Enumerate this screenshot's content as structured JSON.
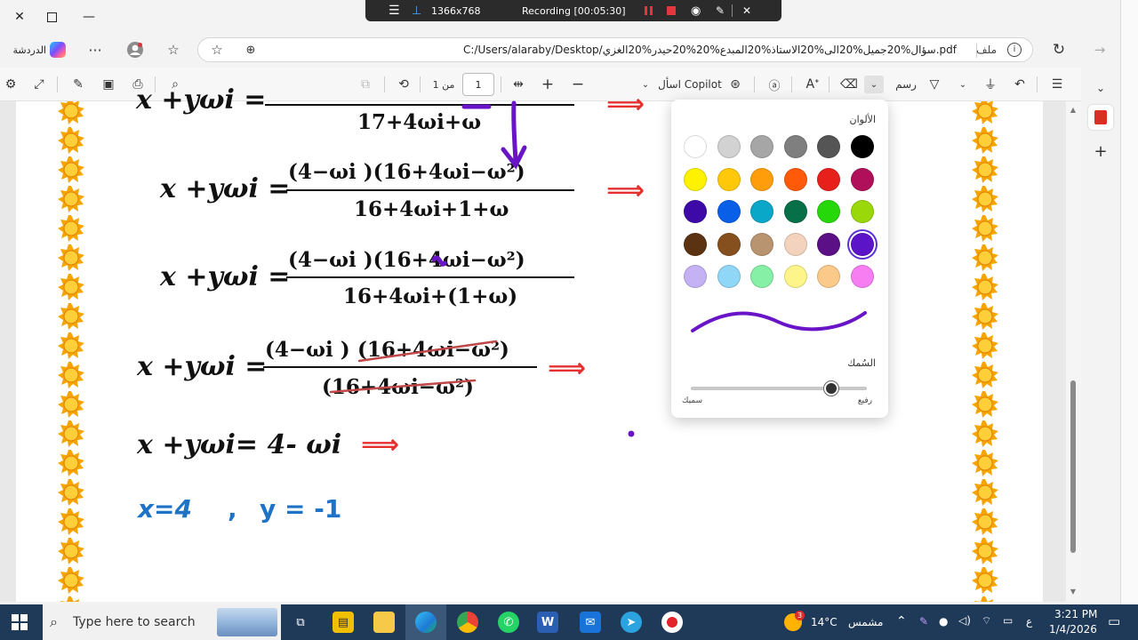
{
  "recorder": {
    "resolution": "1366x768",
    "status": "Recording [00:05:30]"
  },
  "browser": {
    "chat_label": "الدردشة",
    "url": "C:/Users/alaraby/Desktop/سؤال%20جميل%20الى%20الاستاذ%20المبدع%20%20حيدر%20الغزي.pdf",
    "file_label": "ملف",
    "more": "···"
  },
  "pdf_toolbar": {
    "page_of": "من 1",
    "page_value": "1",
    "copilot_label": "اسأل Copilot",
    "draw_label": "رسم"
  },
  "document": {
    "row1": {
      "lhs": "x +yωi =",
      "den": "17+4ωi+ω"
    },
    "row2": {
      "lhs": "x +yωi =",
      "num": "(4−ωi    )(16+4ωi−ω²)",
      "den": "16+4ωi+1+ω"
    },
    "row3": {
      "lhs": "x +yωi =",
      "num": "(4−ωi    )(16+4ωi−ω²)",
      "den": "16+4ωi+(1+ω)"
    },
    "row4": {
      "lhs": "x +yωi =",
      "num_a": "(4−ωi  )",
      "num_b": "(16+4ωi−ω²)",
      "den": "(16+4ωi−ω²)"
    },
    "row5": {
      "text": "x +yωi= 4- ωi"
    },
    "answer": {
      "x": "x=4",
      "sep": ",",
      "y": "y  = -1"
    },
    "arrow": "⟹"
  },
  "color_popup": {
    "title": "الألوان",
    "thickness_label": "السُمك",
    "thin_label": "رفيع",
    "thick_label": "سميك",
    "slider_value": 0.8,
    "colors": [
      "#ffffff",
      "#d2d2d2",
      "#a6a6a6",
      "#7f7f7f",
      "#555555",
      "#000000",
      "#fff200",
      "#ffc80a",
      "#ff9e0a",
      "#ff5a0a",
      "#e8201c",
      "#b0105a",
      "#3d0aa8",
      "#0a5fe8",
      "#0aa7c8",
      "#087048",
      "#26d80a",
      "#9ad80a",
      "#5c3312",
      "#86501e",
      "#b99470",
      "#f4d3be",
      "#5c1086",
      "#5b14c8",
      "#c4b2f5",
      "#8fd6f7",
      "#86f0a6",
      "#fdf58a",
      "#fbc98a",
      "#f77ef2"
    ],
    "selected_index": 23,
    "stroke_color": "#6a14c8"
  },
  "taskbar": {
    "search_placeholder": "Type here to search",
    "weather": "14°C",
    "weather_desc": "مشمس",
    "lang": "ع",
    "time": "3:21 PM",
    "date": "1/4/2026",
    "notif_count": "3"
  }
}
